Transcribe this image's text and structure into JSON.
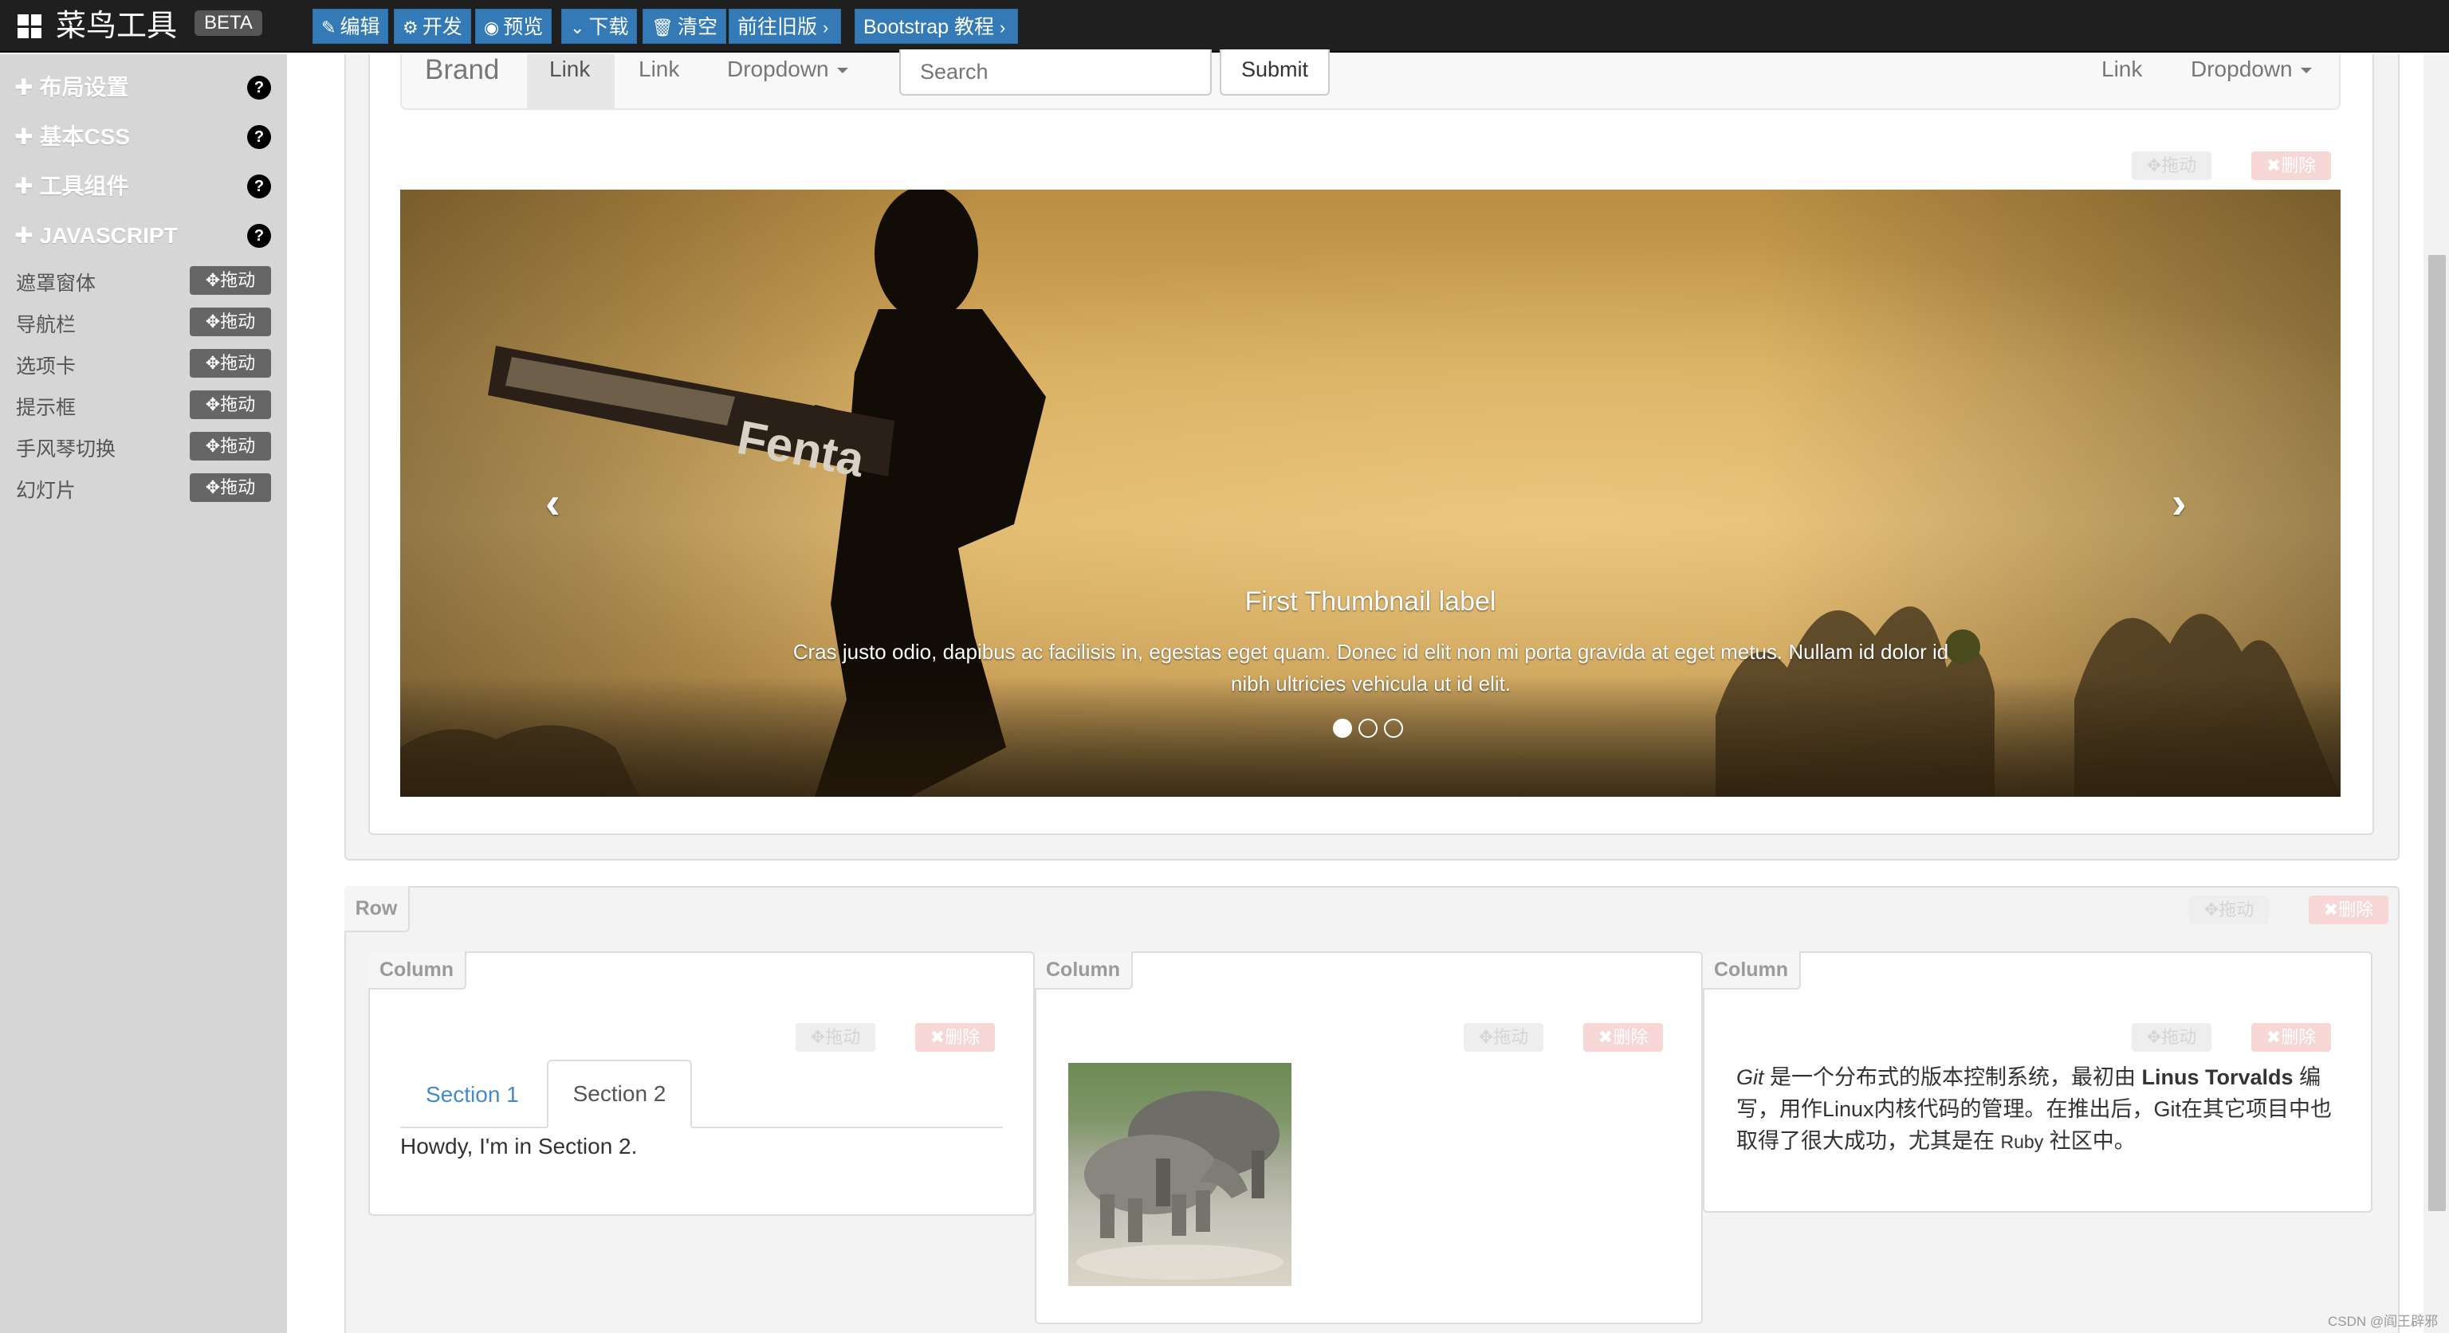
{
  "topbar": {
    "brand": "菜鸟工具",
    "beta": "BETA",
    "buttons": [
      {
        "icon": "edit-icon",
        "glyph": "✎",
        "label": "编辑"
      },
      {
        "icon": "develop-icon",
        "glyph": "⚙",
        "label": "开发"
      },
      {
        "icon": "eye-icon",
        "glyph": "◉",
        "label": "预览"
      },
      {
        "icon": "download-icon",
        "glyph": "⌄",
        "label": "下载"
      },
      {
        "icon": "trash-icon",
        "glyph": "🗑",
        "label": "清空"
      },
      {
        "icon": "chevron-right-icon",
        "glyph": "›",
        "label": "前往旧版"
      },
      {
        "icon": "chevron-right-icon",
        "glyph": "›",
        "label": "Bootstrap 教程"
      }
    ]
  },
  "sidebar": {
    "sections": [
      "布局设置",
      "基本CSS",
      "工具组件",
      "JAVASCRIPT"
    ],
    "help_glyph": "?",
    "items": [
      "遮罩窗体",
      "导航栏",
      "选项卡",
      "提示框",
      "手风琴切换",
      "幻灯片"
    ],
    "drag_label": "拖动"
  },
  "navbar": {
    "brand": "Brand",
    "links_left": [
      "Link",
      "Link"
    ],
    "dropdown_left": "Dropdown",
    "search_placeholder": "Search",
    "submit": "Submit",
    "link_right": "Link",
    "dropdown_right": "Dropdown"
  },
  "controls": {
    "drag": "拖动",
    "delete": "删除"
  },
  "carousel": {
    "caption_title": "First Thumbnail label",
    "caption_text": "Cras justo odio, dapibus ac facilisis in, egestas eget quam. Donec id elit non mi porta gravida at eget metus. Nullam id dolor id nibh ultricies vehicula ut id elit.",
    "prev_glyph": "‹",
    "next_glyph": "›",
    "bat_text": "Fenta",
    "slides": 3,
    "active_slide": 1
  },
  "row": {
    "label": "Row",
    "columns": [
      "Column",
      "Column",
      "Column"
    ]
  },
  "tabs": {
    "tab1": "Section 1",
    "tab2": "Section 2",
    "content": "Howdy, I'm in Section 2."
  },
  "git": {
    "word_git": "Git",
    "part1": " 是一个分布式的版本控制系统，最初由 ",
    "linus": "Linus Torvalds",
    "part2": " 编写，用作Linux内核代码的管理。在推出后，Git在其它项目中也取得了很大成功，尤其是在 ",
    "ruby": "Ruby",
    "part3": " 社区中。"
  },
  "watermark": "CSDN @阎王辟邪"
}
